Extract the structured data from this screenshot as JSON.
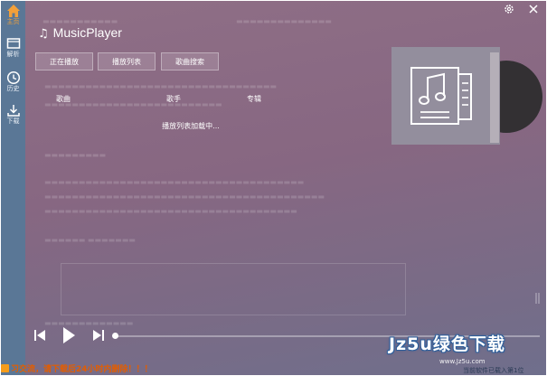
{
  "app": {
    "title": "MusicPlayer",
    "title_icon": "music-note-icon",
    "accent_color": "#f2a03a",
    "sidebar_color": "#5a7796"
  },
  "sidebar": {
    "items": [
      {
        "label": "主页",
        "icon": "home-icon",
        "active": true
      },
      {
        "label": "解析",
        "icon": "film-icon",
        "active": false
      },
      {
        "label": "历史",
        "icon": "clock-icon",
        "active": false
      },
      {
        "label": "下载",
        "icon": "download-icon",
        "active": false
      }
    ]
  },
  "window_controls": {
    "settings_icon": "gear-icon",
    "close_icon": "close-icon"
  },
  "tabs": [
    {
      "label": "正在播放"
    },
    {
      "label": "播放列表"
    },
    {
      "label": "歌曲搜索"
    }
  ],
  "playlist": {
    "columns": [
      "歌曲",
      "歌手",
      "专辑"
    ],
    "loading_text": "播放列表加载中..."
  },
  "album": {
    "icon": "playlist-music-icon"
  },
  "player": {
    "prev_icon": "previous-icon",
    "play_icon": "play-icon",
    "next_icon": "next-icon",
    "progress": 0
  },
  "notice": {
    "text": "习交流，请下载后24小时内删除！！！",
    "color": "#e35d00"
  },
  "watermark": {
    "text": "Jz5u绿色下载",
    "url": "www.Jz5u.com",
    "subtext": "当前软件已载入第1位"
  }
}
